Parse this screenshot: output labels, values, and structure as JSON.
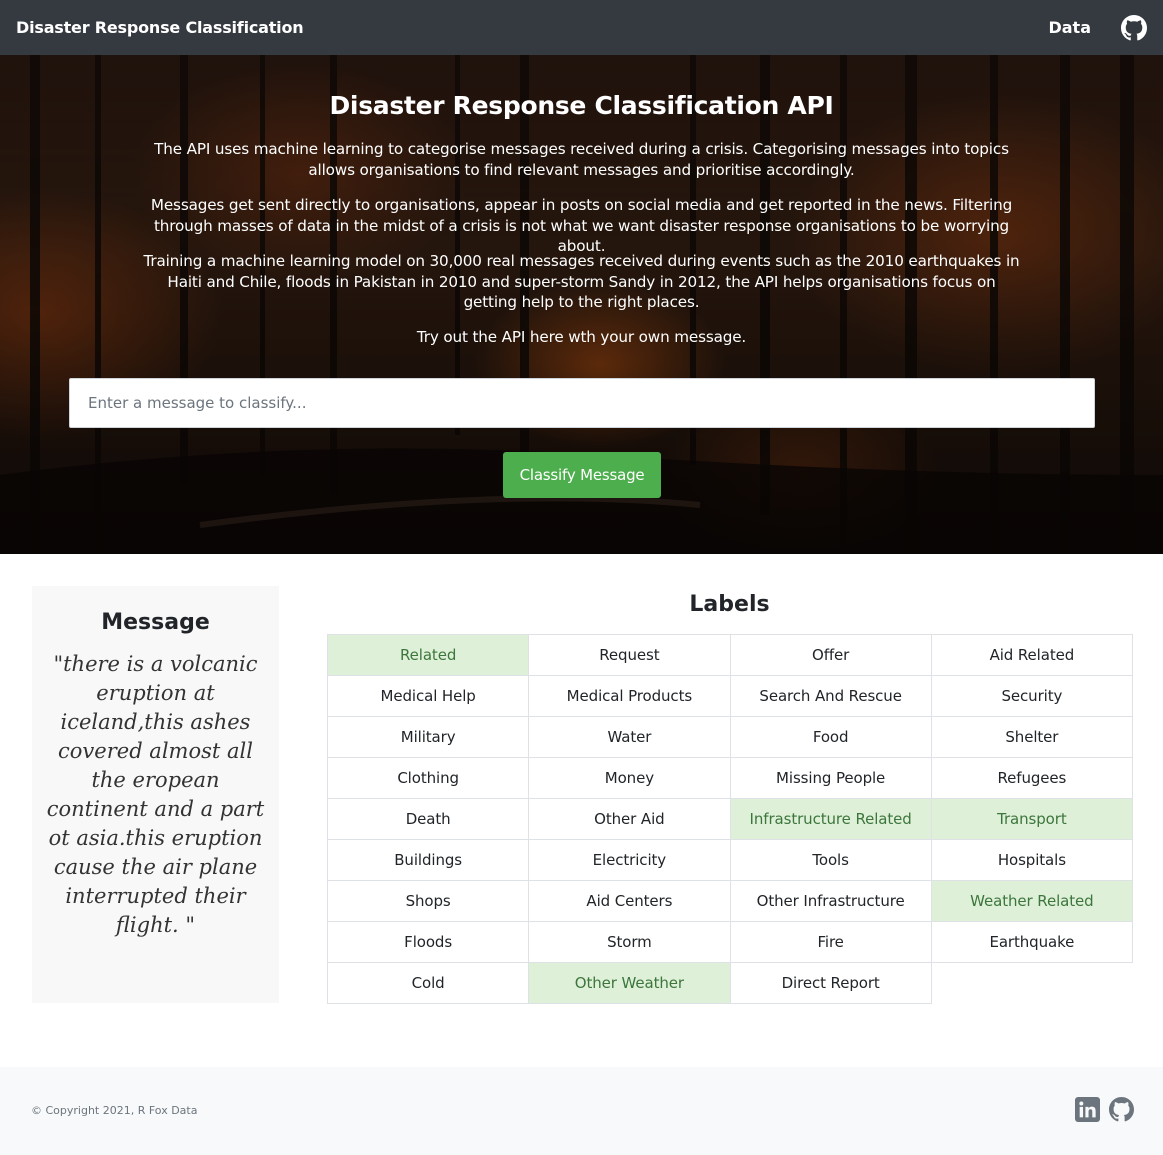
{
  "navbar": {
    "brand": "Disaster Response Classification",
    "data_link": "Data",
    "github_icon": "github-icon"
  },
  "hero": {
    "title": "Disaster Response Classification API",
    "paragraphs": [
      "The API uses machine learning to categorise messages received during a crisis. Categorising messages into topics allows organisations to find relevant messages and prioritise accordingly.",
      "Messages get sent directly to organisations, appear in posts on social media and get reported in the news. Filtering through masses of data in the midst of a crisis is not what we want disaster response organisations to be worrying about.",
      "Training a machine learning model on 30,000 real messages received during events such as the 2010 earthquakes in Haiti and Chile, floods in Pakistan in 2010 and super-storm Sandy in 2012, the API helps organisations focus on getting help to the right places.",
      "Try out the API here wth your own message."
    ],
    "input_placeholder": "Enter a message to classify...",
    "input_value": "",
    "button_label": "Classify Message"
  },
  "message": {
    "heading": "Message",
    "text": "\"there is a volcanic eruption at iceland,this ashes covered almost all the eropean continent and a part ot asia.this eruption cause the air plane interrupted their flight. \""
  },
  "labels": {
    "heading": "Labels",
    "items": [
      {
        "label": "Related",
        "active": true
      },
      {
        "label": "Request",
        "active": false
      },
      {
        "label": "Offer",
        "active": false
      },
      {
        "label": "Aid Related",
        "active": false
      },
      {
        "label": "Medical Help",
        "active": false
      },
      {
        "label": "Medical Products",
        "active": false
      },
      {
        "label": "Search And Rescue",
        "active": false
      },
      {
        "label": "Security",
        "active": false
      },
      {
        "label": "Military",
        "active": false
      },
      {
        "label": "Water",
        "active": false
      },
      {
        "label": "Food",
        "active": false
      },
      {
        "label": "Shelter",
        "active": false
      },
      {
        "label": "Clothing",
        "active": false
      },
      {
        "label": "Money",
        "active": false
      },
      {
        "label": "Missing People",
        "active": false
      },
      {
        "label": "Refugees",
        "active": false
      },
      {
        "label": "Death",
        "active": false
      },
      {
        "label": "Other Aid",
        "active": false
      },
      {
        "label": "Infrastructure Related",
        "active": true
      },
      {
        "label": "Transport",
        "active": true
      },
      {
        "label": "Buildings",
        "active": false
      },
      {
        "label": "Electricity",
        "active": false
      },
      {
        "label": "Tools",
        "active": false
      },
      {
        "label": "Hospitals",
        "active": false
      },
      {
        "label": "Shops",
        "active": false
      },
      {
        "label": "Aid Centers",
        "active": false
      },
      {
        "label": "Other Infrastructure",
        "active": false
      },
      {
        "label": "Weather Related",
        "active": true
      },
      {
        "label": "Floods",
        "active": false
      },
      {
        "label": "Storm",
        "active": false
      },
      {
        "label": "Fire",
        "active": false
      },
      {
        "label": "Earthquake",
        "active": false
      },
      {
        "label": "Cold",
        "active": false
      },
      {
        "label": "Other Weather",
        "active": true
      },
      {
        "label": "Direct Report",
        "active": false
      }
    ]
  },
  "footer": {
    "copyright": "© Copyright 2021, R Fox Data",
    "icons": [
      "linkedin-icon",
      "github-icon"
    ]
  },
  "colors": {
    "navbar": "#343a40",
    "button": "#4cae4c",
    "active_bg": "#dff0d8",
    "active_text": "#3c763d"
  }
}
